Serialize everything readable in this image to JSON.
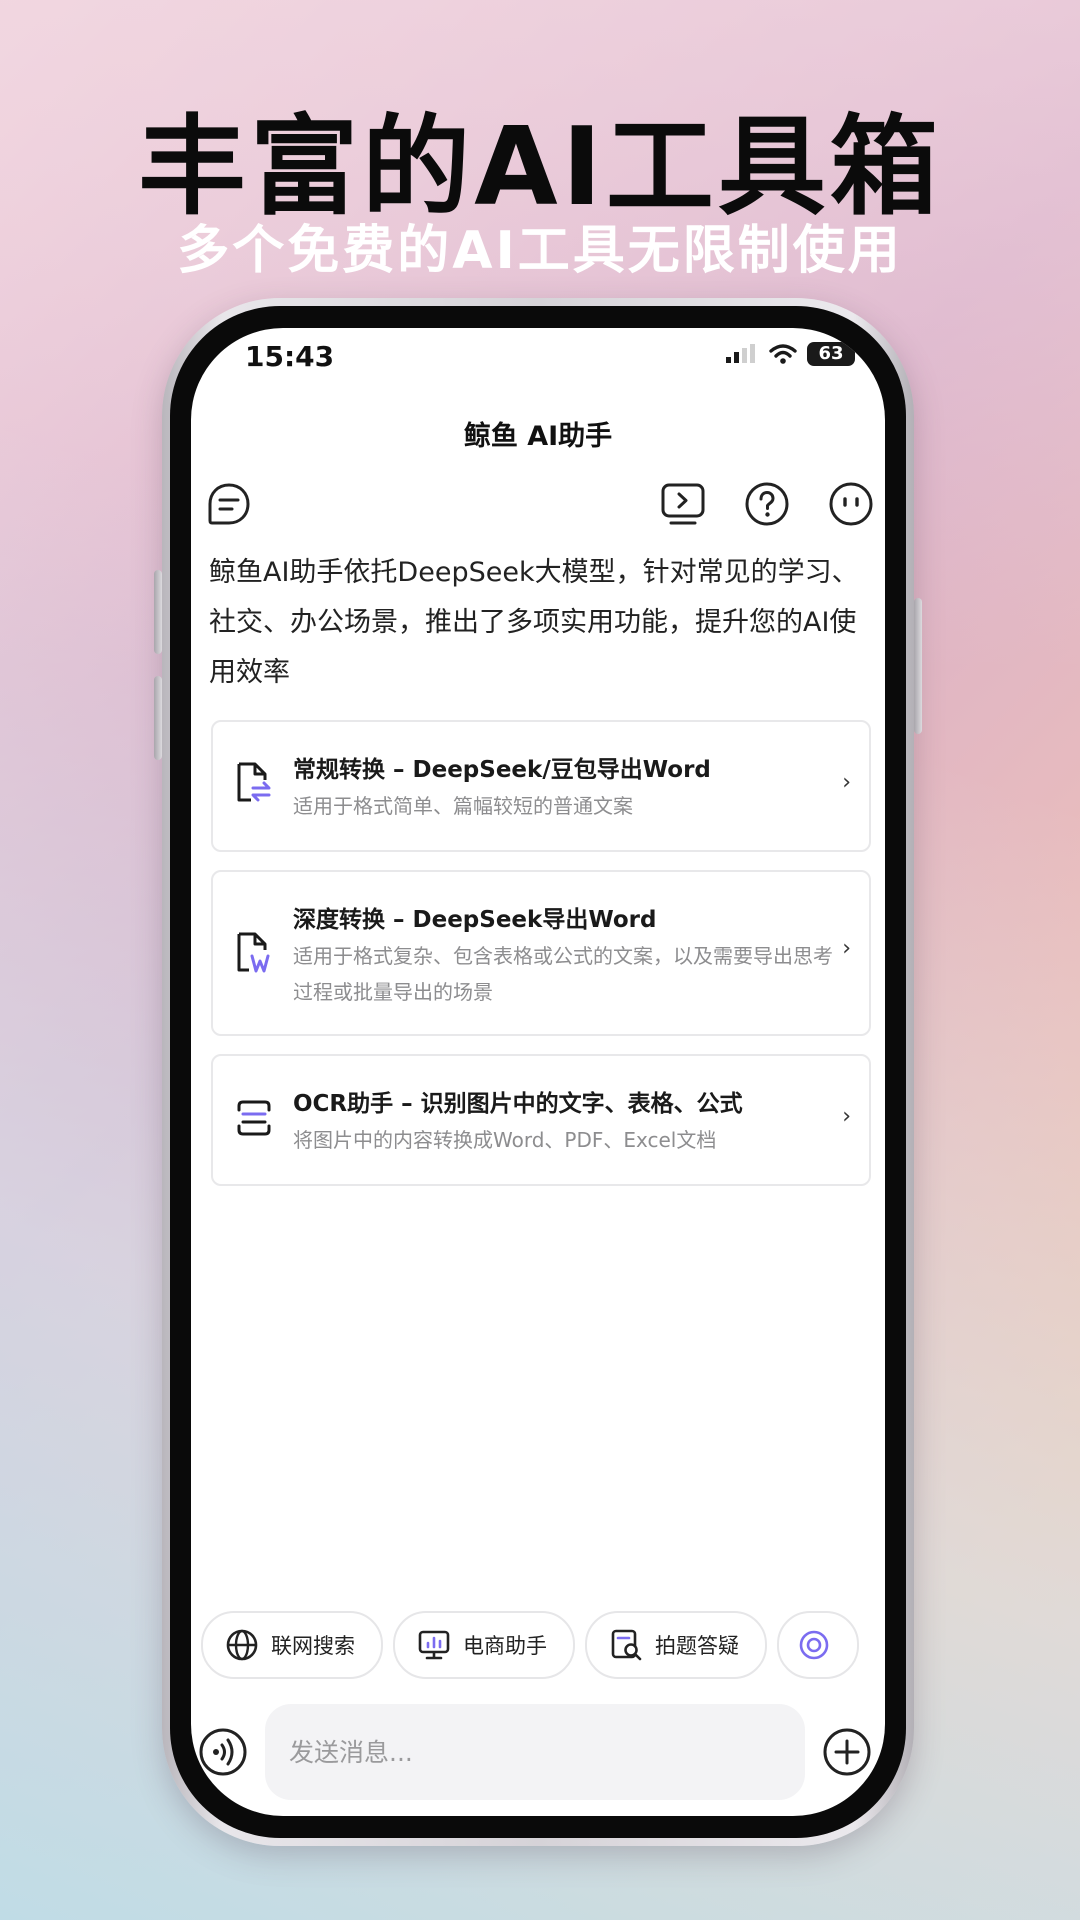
{
  "promo": {
    "headline": "丰富的AI工具箱",
    "subline": "多个免费的AI工具无限制使用"
  },
  "status_bar": {
    "time": "15:43",
    "battery": "63"
  },
  "app": {
    "title": "鲸鱼 AI助手",
    "intro": "鲸鱼AI助手依托DeepSeek大模型，针对常见的学习、社交、办公场景，推出了多项实用功能，提升您的AI使用效率"
  },
  "top_icons": [
    "chat-bubble-icon",
    "video-play-icon",
    "help-icon",
    "face-icon"
  ],
  "cards": [
    {
      "title": "常规转换 – DeepSeek/豆包导出Word",
      "desc": "适用于格式简单、篇幅较短的普通文案",
      "icon": "file-convert-icon"
    },
    {
      "title": "深度转换 – DeepSeek导出Word",
      "desc": "适用于格式复杂、包含表格或公式的文案，以及需要导出思考过程或批量导出的场景",
      "icon": "file-word-icon"
    },
    {
      "title": "OCR助手 – 识别图片中的文字、表格、公式",
      "desc": "将图片中的内容转换成Word、PDF、Excel文档",
      "icon": "scan-icon"
    }
  ],
  "chips": [
    {
      "label": "联网搜索",
      "icon": "globe-icon"
    },
    {
      "label": "电商助手",
      "icon": "monitor-chart-icon"
    },
    {
      "label": "拍题答疑",
      "icon": "search-doc-icon"
    }
  ],
  "composer": {
    "placeholder": "发送消息..."
  },
  "colors": {
    "accent": "#7b6cf0",
    "text": "#222222",
    "muted": "#8d8d8f"
  }
}
